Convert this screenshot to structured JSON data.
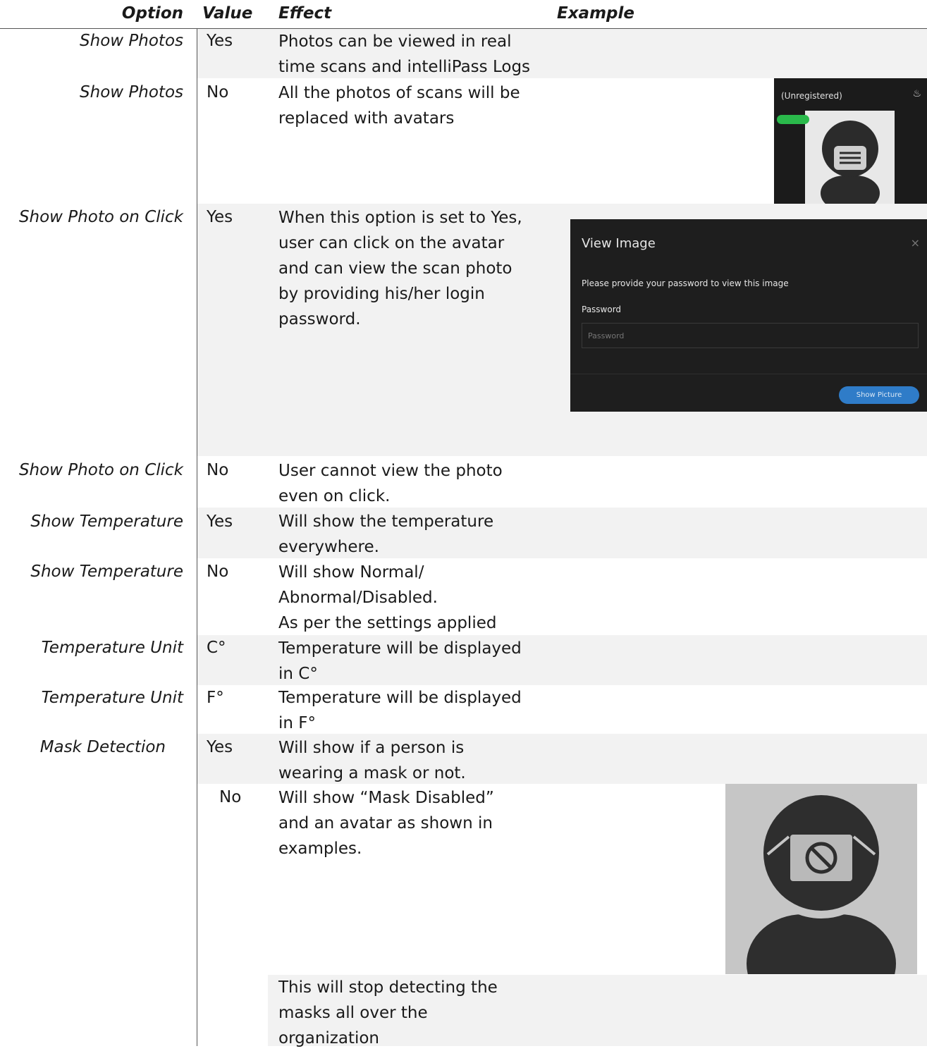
{
  "headers": {
    "option": "Option",
    "value": "Value",
    "effect": "Effect",
    "example": "Example"
  },
  "rows": [
    {
      "option": "Show Photos",
      "value": "Yes",
      "effect": [
        "Photos can be viewed in real",
        "time scans and intelliPass Logs"
      ]
    },
    {
      "option": "Show Photos",
      "value": "No",
      "effect": [
        "All the photos of scans will be",
        "replaced with avatars"
      ]
    },
    {
      "option": "Show Photo on Click",
      "value": "Yes",
      "effect": [
        "When this option is set to Yes,",
        "user can click on the avatar",
        "and can view the scan photo",
        "by providing his/her login",
        "password."
      ]
    },
    {
      "option": "Show Photo on Click",
      "value": "No",
      "effect": [
        "User cannot view the photo",
        "even on click."
      ]
    },
    {
      "option": "Show Temperature",
      "value": "Yes",
      "effect": [
        "Will show the temperature",
        "everywhere."
      ]
    },
    {
      "option": "Show Temperature",
      "value": "No",
      "effect": [
        "Will show Normal/",
        "Abnormal/Disabled.",
        "As per the settings applied"
      ]
    },
    {
      "option": "Temperature Unit",
      "value": "C°",
      "effect": [
        "Temperature will be displayed",
        "in C°"
      ]
    },
    {
      "option": "Temperature Unit",
      "value": "F°",
      "effect": [
        "Temperature will be displayed",
        "in F°"
      ]
    },
    {
      "option": "Mask Detection",
      "value": "Yes",
      "effect": [
        "Will show if a person is",
        "wearing a mask or not."
      ]
    },
    {
      "option": "",
      "value": "No",
      "effect": [
        "Will show “Mask Disabled”",
        "and an avatar as shown in",
        "examples."
      ]
    },
    {
      "option": "",
      "value": "",
      "effect": [
        "This will stop detecting the",
        "masks all over the",
        "organization"
      ]
    }
  ],
  "example_avatar": {
    "name_label": "(Unregistered)"
  },
  "view_image_dialog": {
    "title": "View Image",
    "close": "×",
    "message": "Please provide your password to view this image",
    "password_label": "Password",
    "password_placeholder": "Password",
    "button_label": "Show Picture"
  }
}
